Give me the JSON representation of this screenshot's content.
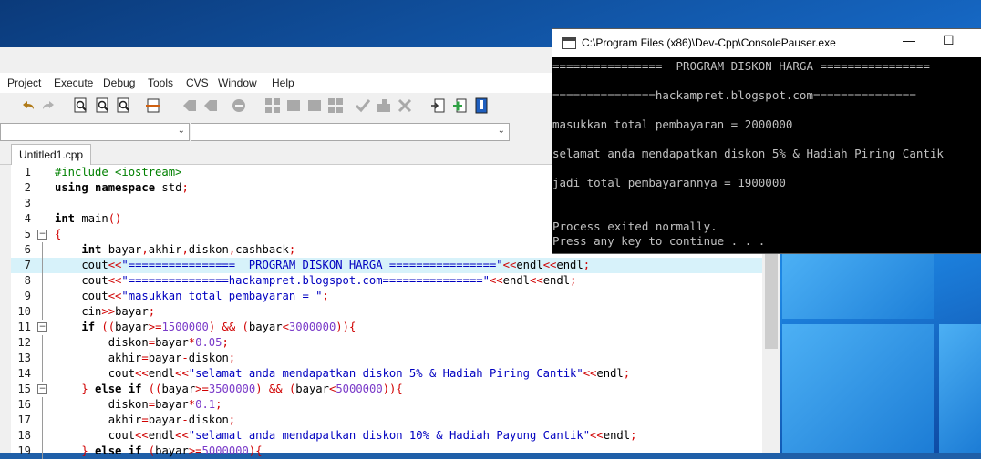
{
  "menu": [
    "Project",
    "Execute",
    "Debug",
    "Tools",
    "CVS",
    "Window",
    "Help"
  ],
  "tab_label": "Untitled1.cpp",
  "console": {
    "title": "C:\\Program Files (x86)\\Dev-Cpp\\ConsolePauser.exe",
    "lines": [
      "================  PROGRAM DISKON HARGA ================",
      "===============hackampret.blogspot.com===============",
      "masukkan total pembayaran = 2000000",
      "selamat anda mendapatkan diskon 5% & Hadiah Piring Cantik",
      "jadi total pembayarannya = 1900000",
      "Process exited normally.",
      "Press any key to continue . . ."
    ]
  },
  "code_lines": [
    {
      "n": "1",
      "text": "#include <iostream>"
    },
    {
      "n": "2",
      "text": "using namespace std;"
    },
    {
      "n": "3",
      "text": ""
    },
    {
      "n": "4",
      "text": "int main()"
    },
    {
      "n": "5",
      "text": "{"
    },
    {
      "n": "6",
      "text": "    int bayar,akhir,diskon,cashback;"
    },
    {
      "n": "7",
      "text": "    cout<<\"================  PROGRAM DISKON HARGA ================\"<<endl<<endl;"
    },
    {
      "n": "8",
      "text": "    cout<<\"===============hackampret.blogspot.com===============\"<<endl<<endl;"
    },
    {
      "n": "9",
      "text": "    cout<<\"masukkan total pembayaran = \";"
    },
    {
      "n": "10",
      "text": "    cin>>bayar;"
    },
    {
      "n": "11",
      "text": "    if ((bayar>=1500000) && (bayar<3000000)){"
    },
    {
      "n": "12",
      "text": "        diskon=bayar*0.05;"
    },
    {
      "n": "13",
      "text": "        akhir=bayar-diskon;"
    },
    {
      "n": "14",
      "text": "        cout<<endl<<\"selamat anda mendapatkan diskon 5% & Hadiah Piring Cantik\"<<endl;"
    },
    {
      "n": "15",
      "text": "    } else if ((bayar>=3500000) && (bayar<5000000)){"
    },
    {
      "n": "16",
      "text": "        diskon=bayar*0.1;"
    },
    {
      "n": "17",
      "text": "        akhir=bayar-diskon;"
    },
    {
      "n": "18",
      "text": "        cout<<endl<<\"selamat anda mendapatkan diskon 10% & Hadiah Payung Cantik\"<<endl;"
    },
    {
      "n": "19",
      "text": "    } else if (bayar>=5000000){"
    }
  ],
  "highlight_line": "7",
  "fold_lines": [
    "5",
    "11",
    "15"
  ],
  "icons": [
    "undo-icon",
    "redo-icon",
    "find-icon",
    "replace-icon",
    "find-next-icon",
    "goto-line-icon",
    "indent-icon",
    "unindent-icon",
    "toggle-comment-icon",
    "new-project-icon",
    "add-file-icon",
    "remove-file-icon",
    "project-options-icon",
    "syntax-check-icon",
    "compile-icon",
    "stop-icon",
    "class-browser-icon",
    "add-icon",
    "bookmark-icon"
  ]
}
